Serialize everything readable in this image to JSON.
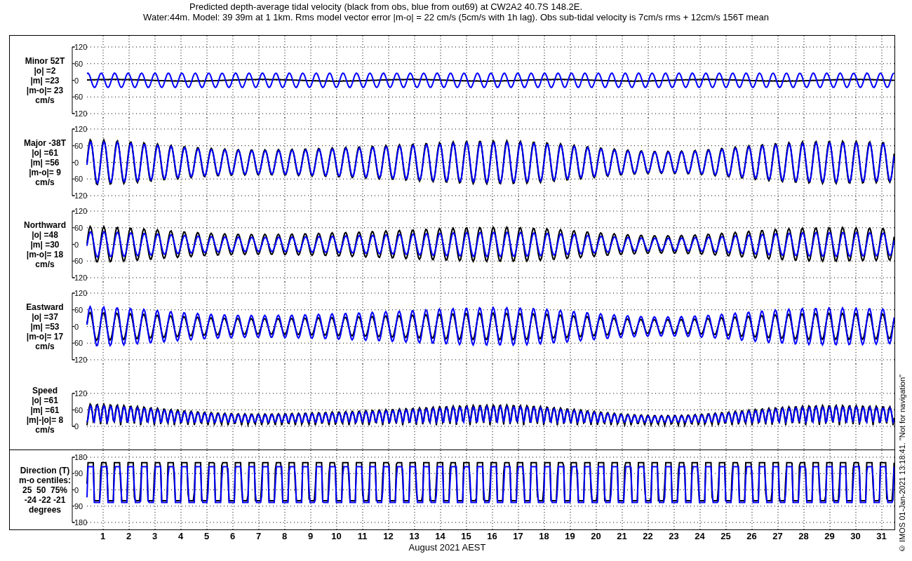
{
  "title": {
    "lines": [
      "Predicted depth-average tidal velocity (black from obs, blue from out69) at CW2A2 40.7S 148.2E.",
      "Water:44m. Model: 39 39m at 1 1km. Rms model vector error |m-o| = 22 cm/s (5cm/s with 1h lag). Obs sub-tidal velocity is 7cm/s rms + 12cm/s 156T mean"
    ]
  },
  "panels": [
    {
      "kind": "minor",
      "label_lines": [
        "Minor 52T",
        "|o| =2",
        "|m| =23",
        "|m-o|= 23",
        "cm/s"
      ],
      "yticks": [
        "120",
        "60",
        "0",
        "60",
        "120"
      ]
    },
    {
      "kind": "major",
      "label_lines": [
        "Major -38T",
        "|o| =61",
        "|m| =56",
        "|m-o|= 9",
        "cm/s"
      ],
      "yticks": [
        "120",
        "60",
        "0",
        "60",
        "120"
      ]
    },
    {
      "kind": "north",
      "label_lines": [
        "Northward",
        "|o| =48",
        "|m| =30",
        "|m-o|= 18",
        "cm/s"
      ],
      "yticks": [
        "120",
        "60",
        "0",
        "60",
        "120"
      ]
    },
    {
      "kind": "east",
      "label_lines": [
        "Eastward",
        "|o| =37",
        "|m| =53",
        "|m-o|= 17",
        "cm/s"
      ],
      "yticks": [
        "120",
        "60",
        "0",
        "60",
        "120"
      ]
    },
    {
      "kind": "speed",
      "label_lines": [
        "Speed",
        "|o| =61",
        "|m| =61",
        "|m|-|o|= 8",
        "cm/s"
      ],
      "yticks": [
        "120",
        "60",
        "0"
      ]
    },
    {
      "kind": "direction",
      "label_lines": [
        "Direction (T)",
        "m-o centiles:",
        "25  50  75%",
        "-24 -22 -21",
        "degrees"
      ],
      "yticks": [
        "180",
        "90",
        "0",
        "90",
        "180"
      ]
    }
  ],
  "xaxis": {
    "ticks": [
      "1",
      "2",
      "3",
      "4",
      "5",
      "6",
      "7",
      "8",
      "9",
      "10",
      "11",
      "12",
      "13",
      "14",
      "15",
      "16",
      "17",
      "18",
      "19",
      "20",
      "21",
      "22",
      "23",
      "24",
      "25",
      "26",
      "27",
      "28",
      "29",
      "30",
      "31"
    ],
    "label": "August 2021 AEST"
  },
  "footer": "© IMOS 01-Jan-2021 13:18:41. \"Not for navigation\""
}
